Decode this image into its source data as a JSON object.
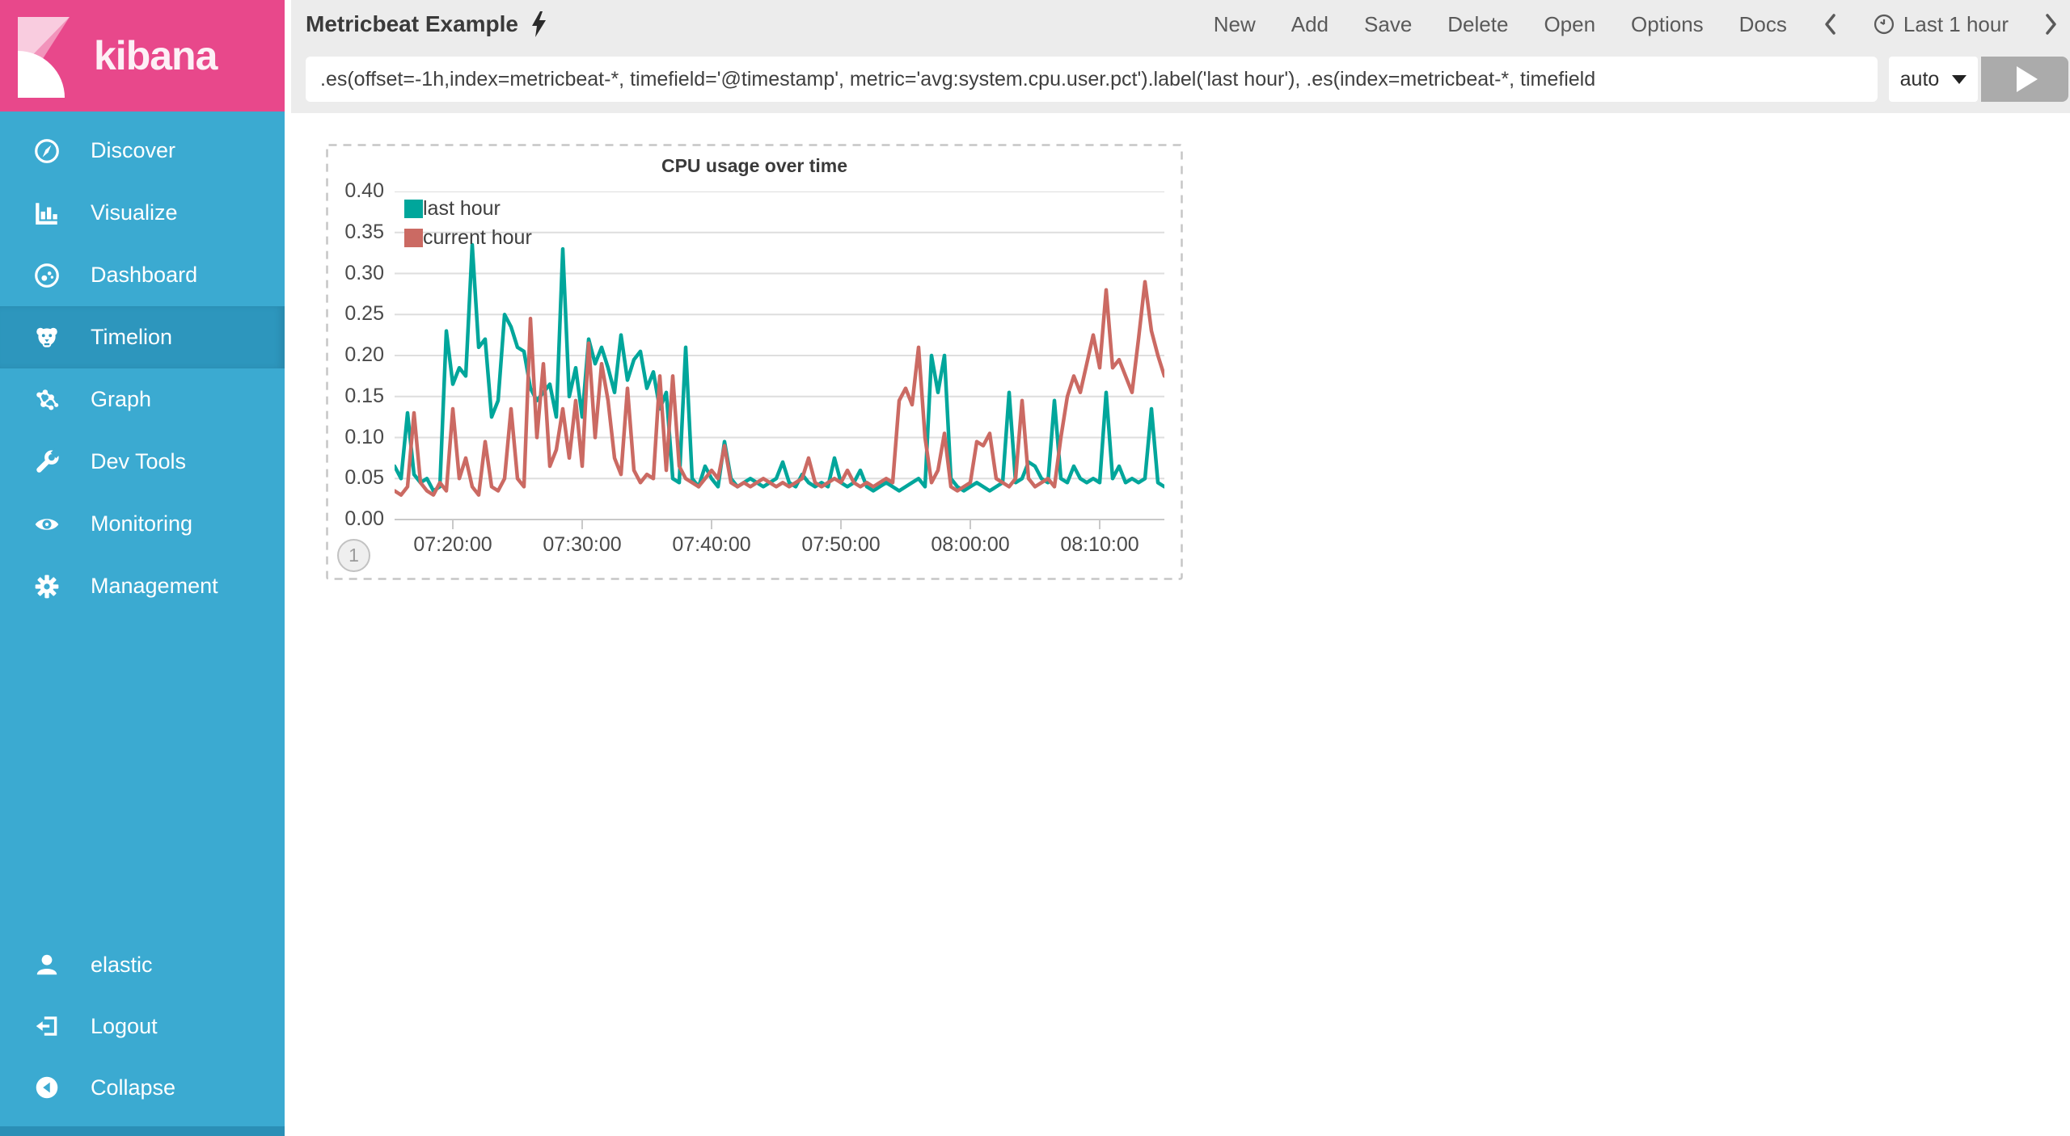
{
  "app": {
    "logo_text": "kibana"
  },
  "sidebar": {
    "items": [
      {
        "label": "Discover",
        "icon": "compass-icon"
      },
      {
        "label": "Visualize",
        "icon": "bar-chart-icon"
      },
      {
        "label": "Dashboard",
        "icon": "gauge-icon"
      },
      {
        "label": "Timelion",
        "icon": "lion-icon"
      },
      {
        "label": "Graph",
        "icon": "network-icon"
      },
      {
        "label": "Dev Tools",
        "icon": "wrench-icon"
      },
      {
        "label": "Monitoring",
        "icon": "eye-icon"
      },
      {
        "label": "Management",
        "icon": "gear-icon"
      }
    ],
    "selected": "Timelion",
    "footer": [
      {
        "label": "elastic",
        "icon": "user-icon"
      },
      {
        "label": "Logout",
        "icon": "logout-icon"
      },
      {
        "label": "Collapse",
        "icon": "collapse-circle-icon"
      }
    ]
  },
  "topbar": {
    "title": "Metricbeat Example",
    "title_icon": "lightning-bolt-icon",
    "menu": [
      "New",
      "Add",
      "Save",
      "Delete",
      "Open",
      "Options",
      "Docs"
    ],
    "time_label": "Last 1 hour"
  },
  "query": {
    "value": ".es(offset=-1h,index=metricbeat-*, timefield='@timestamp', metric='avg:system.cpu.user.pct').label('last hour'), .es(index=metricbeat-*, timefield",
    "interval": "auto"
  },
  "panel": {
    "badge": "1"
  },
  "colors": {
    "sidebar": "#3BAAD1",
    "sidebar_selected": "#2D96BD",
    "logo_pink": "#E8488B",
    "topbar_bg": "#ECECEC",
    "series_teal": "#00A69B",
    "series_red": "#CB6A63"
  },
  "chart_data": {
    "type": "line",
    "title": "CPU usage over time",
    "xlabel": "",
    "ylabel": "",
    "x_start": "07:15:30",
    "x_interval_seconds": 30,
    "x_tick_indices": [
      9,
      29,
      49,
      69,
      89,
      109
    ],
    "x_tick_labels": [
      "07:20:00",
      "07:30:00",
      "07:40:00",
      "07:50:00",
      "08:00:00",
      "08:10:00"
    ],
    "ylim": [
      0,
      0.4
    ],
    "y_tick_step": 0.05,
    "grid": true,
    "legend_position": "top-left",
    "series": [
      {
        "name": "last hour",
        "color": "#00A69B",
        "values": [
          0.065,
          0.05,
          0.13,
          0.055,
          0.045,
          0.05,
          0.035,
          0.04,
          0.23,
          0.165,
          0.185,
          0.175,
          0.335,
          0.21,
          0.22,
          0.125,
          0.145,
          0.25,
          0.235,
          0.21,
          0.205,
          0.16,
          0.145,
          0.155,
          0.165,
          0.125,
          0.33,
          0.15,
          0.185,
          0.125,
          0.22,
          0.19,
          0.21,
          0.185,
          0.155,
          0.225,
          0.17,
          0.195,
          0.205,
          0.16,
          0.18,
          0.135,
          0.155,
          0.05,
          0.045,
          0.21,
          0.05,
          0.04,
          0.065,
          0.05,
          0.04,
          0.095,
          0.05,
          0.04,
          0.045,
          0.05,
          0.045,
          0.04,
          0.045,
          0.05,
          0.07,
          0.045,
          0.04,
          0.055,
          0.045,
          0.04,
          0.045,
          0.04,
          0.075,
          0.045,
          0.04,
          0.045,
          0.06,
          0.04,
          0.035,
          0.04,
          0.045,
          0.04,
          0.035,
          0.04,
          0.045,
          0.05,
          0.04,
          0.2,
          0.155,
          0.2,
          0.05,
          0.04,
          0.035,
          0.04,
          0.045,
          0.04,
          0.035,
          0.04,
          0.045,
          0.155,
          0.045,
          0.05,
          0.07,
          0.065,
          0.05,
          0.045,
          0.145,
          0.05,
          0.045,
          0.065,
          0.05,
          0.045,
          0.05,
          0.045,
          0.155,
          0.05,
          0.065,
          0.045,
          0.05,
          0.045,
          0.05,
          0.135,
          0.045,
          0.04
        ]
      },
      {
        "name": "current hour",
        "color": "#CB6A63",
        "values": [
          0.035,
          0.03,
          0.04,
          0.13,
          0.045,
          0.035,
          0.03,
          0.045,
          0.035,
          0.135,
          0.05,
          0.075,
          0.04,
          0.03,
          0.095,
          0.04,
          0.035,
          0.05,
          0.135,
          0.05,
          0.04,
          0.245,
          0.1,
          0.19,
          0.065,
          0.085,
          0.135,
          0.075,
          0.145,
          0.065,
          0.215,
          0.1,
          0.19,
          0.145,
          0.075,
          0.055,
          0.16,
          0.06,
          0.045,
          0.055,
          0.05,
          0.175,
          0.06,
          0.175,
          0.065,
          0.05,
          0.045,
          0.04,
          0.05,
          0.06,
          0.05,
          0.09,
          0.045,
          0.04,
          0.045,
          0.04,
          0.045,
          0.05,
          0.045,
          0.04,
          0.045,
          0.04,
          0.045,
          0.05,
          0.075,
          0.045,
          0.04,
          0.045,
          0.05,
          0.045,
          0.06,
          0.045,
          0.04,
          0.045,
          0.04,
          0.045,
          0.05,
          0.045,
          0.145,
          0.16,
          0.14,
          0.21,
          0.1,
          0.045,
          0.06,
          0.105,
          0.04,
          0.035,
          0.04,
          0.045,
          0.095,
          0.09,
          0.105,
          0.05,
          0.045,
          0.04,
          0.05,
          0.145,
          0.05,
          0.04,
          0.045,
          0.05,
          0.04,
          0.1,
          0.15,
          0.175,
          0.155,
          0.19,
          0.225,
          0.185,
          0.28,
          0.185,
          0.195,
          0.175,
          0.155,
          0.22,
          0.29,
          0.23,
          0.2,
          0.175
        ]
      }
    ]
  }
}
